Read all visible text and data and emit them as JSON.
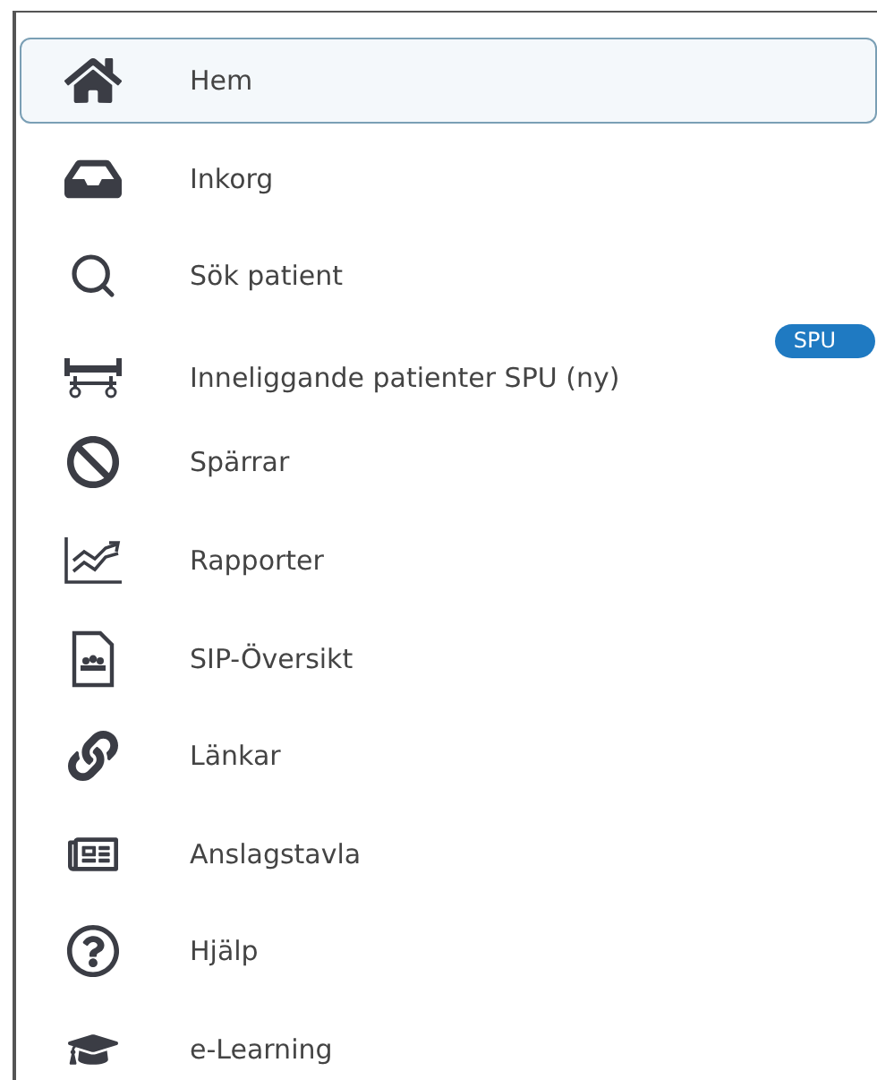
{
  "menu": {
    "items": [
      {
        "label": "Hem",
        "selected": true
      },
      {
        "label": "Inkorg",
        "selected": false
      },
      {
        "label": "Sök patient",
        "selected": false
      },
      {
        "label": "Inneliggande patienter SPU (ny)",
        "selected": false,
        "badge": "SPU"
      },
      {
        "label": "Spärrar",
        "selected": false
      },
      {
        "label": "Rapporter",
        "selected": false
      },
      {
        "label": "SIP-Översikt",
        "selected": false
      },
      {
        "label": "Länkar",
        "selected": false
      },
      {
        "label": "Anslagstavla",
        "selected": false
      },
      {
        "label": "Hjälp",
        "selected": false
      },
      {
        "label": "e-Learning",
        "selected": false
      }
    ]
  }
}
